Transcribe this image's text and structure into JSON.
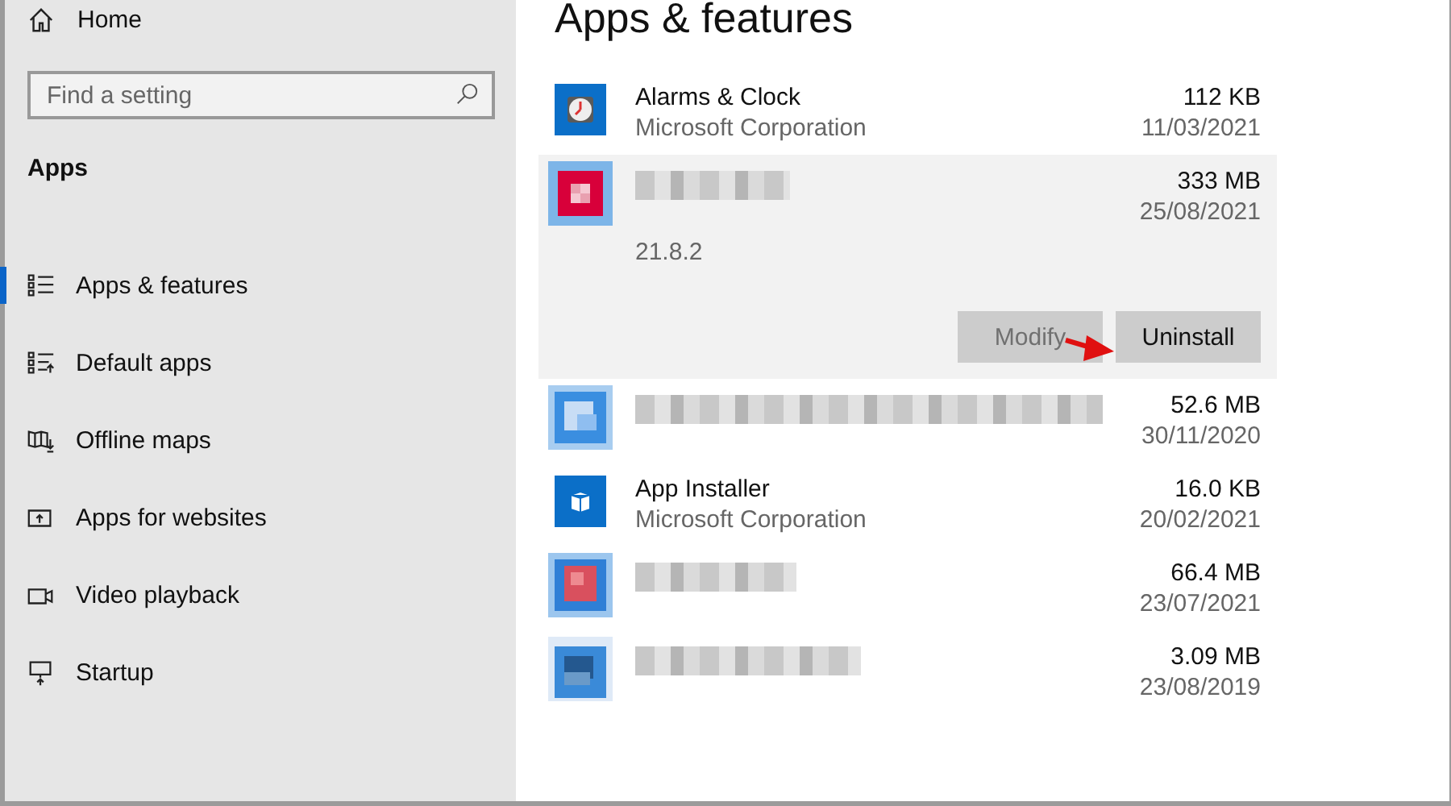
{
  "sidebar": {
    "home": "Home",
    "search": {
      "placeholder": "Find a setting"
    },
    "section": "Apps",
    "items": [
      {
        "label": "Apps & features",
        "selected": true
      },
      {
        "label": "Default apps",
        "selected": false
      },
      {
        "label": "Offline maps",
        "selected": false
      },
      {
        "label": "Apps for websites",
        "selected": false
      },
      {
        "label": "Video playback",
        "selected": false
      },
      {
        "label": "Startup",
        "selected": false
      }
    ]
  },
  "main": {
    "title": "Apps & features",
    "apps": [
      {
        "kind": "named",
        "name": "Alarms & Clock",
        "publisher": "Microsoft Corporation",
        "size": "112 KB",
        "date": "11/03/2021",
        "selected": false
      },
      {
        "kind": "redacted",
        "size": "333 MB",
        "date": "25/08/2021",
        "version": "21.8.2",
        "selected": true,
        "buttons": [
          {
            "label": "Modify",
            "disabled": true
          },
          {
            "label": "Uninstall",
            "disabled": false
          }
        ]
      },
      {
        "kind": "redacted",
        "size": "52.6 MB",
        "date": "30/11/2020",
        "selected": false
      },
      {
        "kind": "named",
        "name": "App Installer",
        "publisher": "Microsoft Corporation",
        "size": "16.0 KB",
        "date": "20/02/2021",
        "selected": false
      },
      {
        "kind": "redacted",
        "size": "66.4 MB",
        "date": "23/07/2021",
        "selected": false
      },
      {
        "kind": "redacted",
        "size": "3.09 MB",
        "date": "23/08/2019",
        "selected": false
      }
    ]
  }
}
